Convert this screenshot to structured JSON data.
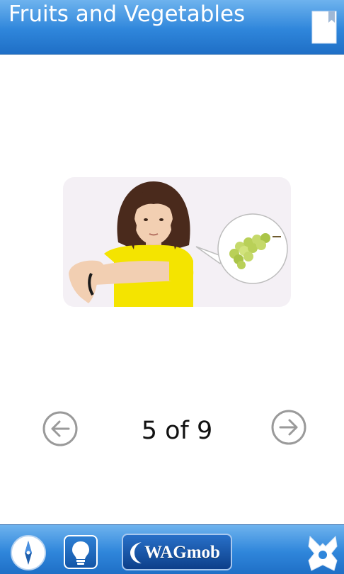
{
  "header": {
    "title": "Fruits and Vegetables",
    "bookmark_icon": "bookmark-icon"
  },
  "card": {
    "image_subject": "child signing grapes",
    "thought_bubble_icon": "grapes-icon"
  },
  "pager": {
    "prev_icon": "arrow-left-circle-icon",
    "next_icon": "arrow-right-circle-icon",
    "indicator": "5 of 9",
    "current": 5,
    "total": 9
  },
  "bottombar": {
    "compass_icon": "compass-icon",
    "tip_icon": "lightbulb-icon",
    "brand_label": "WAGmob",
    "menu_icon": "menu-icon"
  },
  "colors": {
    "bar_blue": "#2f86db",
    "bar_blue_light": "#6eb3ee",
    "card_bg": "#f4f0f5",
    "arrow_gray": "#9a9a9a"
  }
}
